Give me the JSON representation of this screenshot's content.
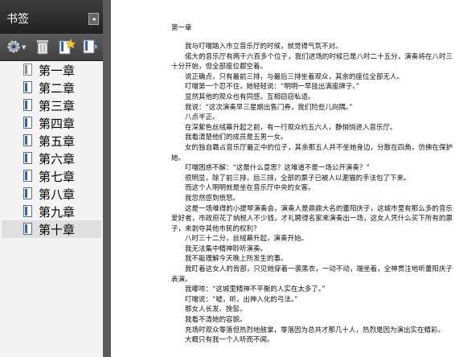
{
  "sidebar": {
    "title": "书签",
    "collapse_glyph": "◂",
    "toolbar": {
      "options_icon": "gear-icon",
      "delete_icon": "trash-icon",
      "new_icon": "new-bookmark-icon",
      "expand_icon": "export-icon"
    },
    "items": [
      {
        "label": "第一章",
        "selected": false
      },
      {
        "label": "第二章",
        "selected": false
      },
      {
        "label": "第三章",
        "selected": false
      },
      {
        "label": "第四章",
        "selected": false
      },
      {
        "label": "第五章",
        "selected": false
      },
      {
        "label": "第六章",
        "selected": false
      },
      {
        "label": "第七章",
        "selected": false
      },
      {
        "label": "第八章",
        "selected": false
      },
      {
        "label": "第九章",
        "selected": false
      },
      {
        "label": "第十章",
        "selected": true
      }
    ]
  },
  "document": {
    "title": "第一章",
    "paragraphs": [
      "我与叮噹踏入市立音乐厅的时候，就觉得气氛不对。",
      "偌大的音乐厅有两千六百多个位子，我们进场的时候已是八时二十五分，演奏将在八时三十分开始，但全部座位都空着。",
      "说正确点，只有最前三排，与最后三排坐着观众，其余的座位全部无人。",
      "叮噹第一个忍不住，她轻轻说：“明明一早挂出满座牌子。”",
      "显然其他的观众也有同感，互相窃窃私语。",
      "我说：“这次演奏早三星期出售门券，我们险些儿向隅。”",
      "八点半正。",
      "在深紫色丝绒幕升起之前，有一行观众约五六人，静悄悄进入音乐厅。",
      "我看清楚他们的成员是五男一女。",
      "女的独自霸占音乐厅最正中的位子，其余那五人并不坐她身边，分散在四角，仿佛在保护她。",
      "叮噹困惑不解：“这是什么意思？这难道不是一场公开演奏？”",
      "很明显，除了前三排，后三排，全部的票子已被人以淝猫的手法包了下来。",
      "而这个人明明就是坐在音乐厅中央的女客。",
      "我忽然感到愤怒。",
      "这是一场难得的小提琴演奏会，演奏人是鼎鼎大名的董阳庆子，这城市里有那么多的音乐爱好者，市政府花了纳税人不少钱，才礼聘得名家来演奏出一场，这女人凭什么买下所有的票子，来剥夺其他市民的权利？",
      "八时三十二分，丝绒幕升起，演奏开始。",
      "我无法集中精神聆听演奏。",
      "我不能理解今天晚上所发生的事。",
      "我盯着这女人的背部，只见她穿着一袭黑衣，一动不动，端坐着，全神贯注地听董阳庆子表演。",
      "我嘟哝：“这城里精神不平衡的人实在太多了。”",
      "叮噹说：“嘘，听，出神入化的弓法。”",
      "那女人长发、挽髻。",
      "我看不清她的容貌。",
      "充场时观众零落但热烈地鼓掌，零落因为总共才那几十人，热烈是因为演出实在精彩。",
      "大概只有我一个人听而不闻。"
    ]
  }
}
